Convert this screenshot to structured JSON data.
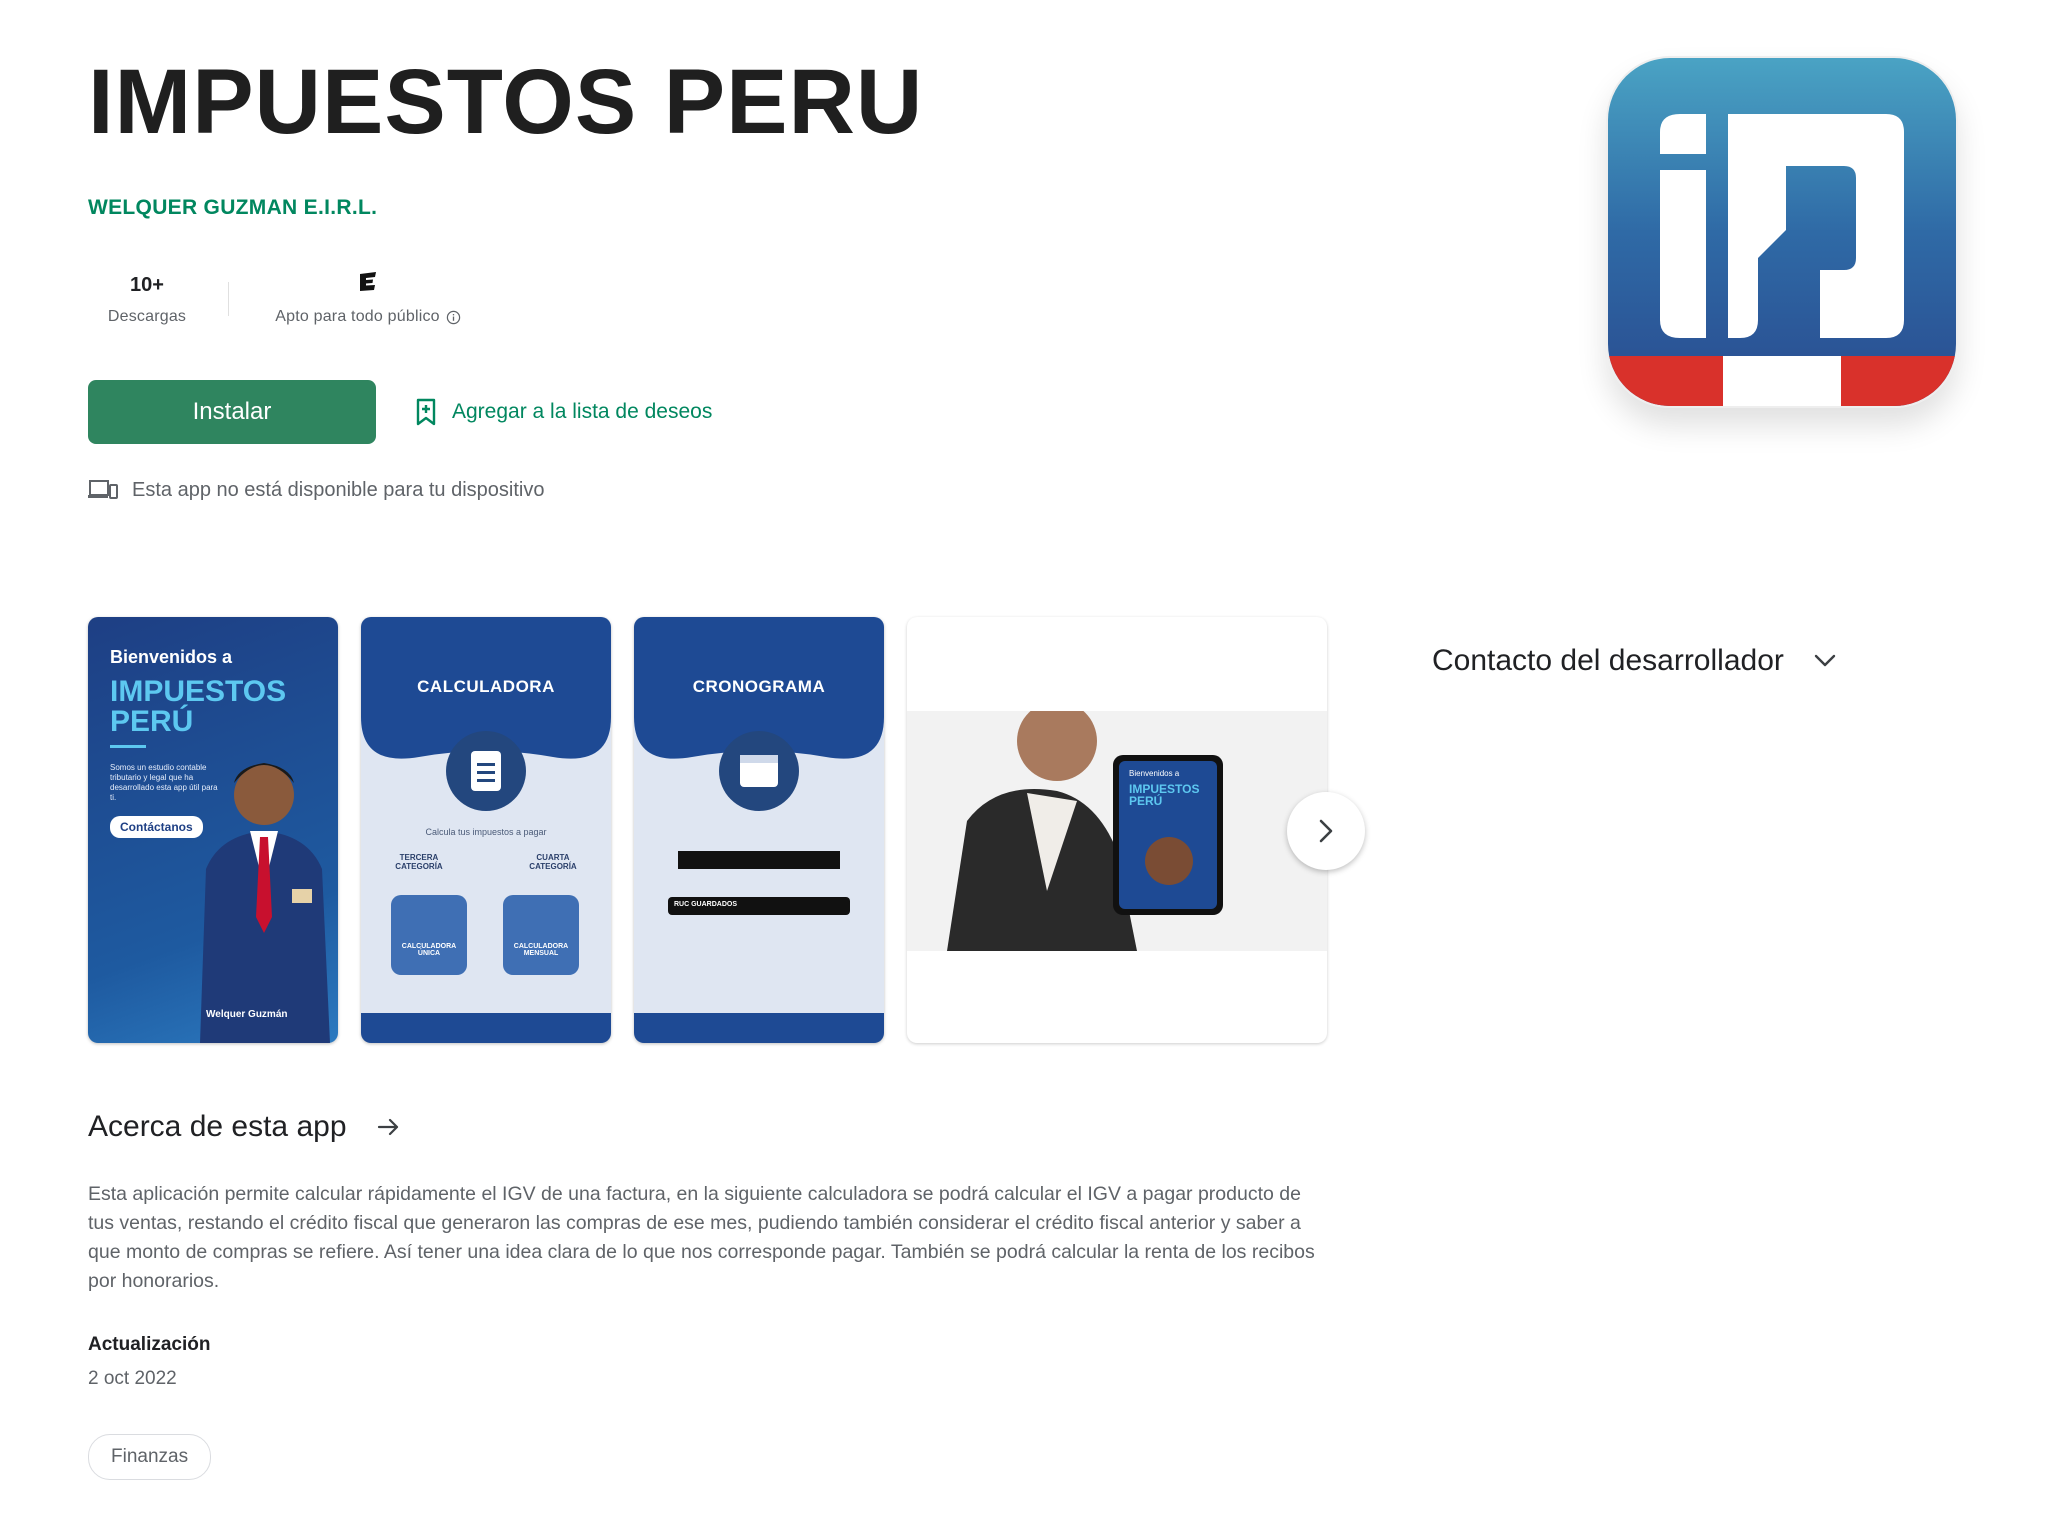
{
  "app": {
    "title": "IMPUESTOS PERU",
    "developer": "WELQUER GUZMAN E.I.R.L."
  },
  "stats": {
    "downloads_value": "10+",
    "downloads_label": "Descargas",
    "rating_label": "Apto para todo público",
    "rating_icon": "esrb-everyone-icon"
  },
  "actions": {
    "install_label": "Instalar",
    "wishlist_label": "Agregar a la lista de deseos"
  },
  "availability": {
    "text": "Esta app no está disponible para tu dispositivo"
  },
  "screenshots": {
    "shot1": {
      "welcome": "Bienvenidos a",
      "title": "IMPUESTOS PERÚ",
      "desc": "Somos un estudio contable tributario y legal que ha desarrollado esta app útil para ti.",
      "button": "Contáctanos",
      "brand": "Welquer Guzmán"
    },
    "shot2": {
      "title": "CALCULADORA",
      "subtitle": "Calcula tus impuestos a pagar",
      "left_toggle": "TERCERA CATEGORÍA",
      "right_toggle": "CUARTA CATEGORÍA",
      "tile1": "CALCULADORA ÚNICA",
      "tile2": "CALCULADORA MENSUAL"
    },
    "shot3": {
      "title": "CRONOGRAMA",
      "select": "RUC GUARDADOS"
    },
    "shot4": {
      "welcome": "Bienvenidos a",
      "title": "IMPUESTOS PERÚ"
    }
  },
  "contact": {
    "label": "Contacto del desarrollador"
  },
  "about": {
    "title": "Acerca de esta app",
    "text": "Esta aplicación permite calcular rápidamente el IGV de una factura, en la siguiente calculadora se podrá calcular el IGV a pagar producto de tus ventas, restando el crédito fiscal que generaron las compras de ese mes, pudiendo también considerar el crédito fiscal anterior y saber a que monto de compras se refiere. Así tener una idea clara de lo que nos corresponde pagar. También se podrá calcular la renta de los recibos por honorarios.",
    "updated_label": "Actualización",
    "updated_value": "2 oct 2022",
    "category": "Finanzas"
  },
  "colors": {
    "accent_green": "#01875f",
    "install_bg": "#2f855f",
    "icon_blue": "#2c5e9e",
    "icon_red": "#d9312b"
  }
}
